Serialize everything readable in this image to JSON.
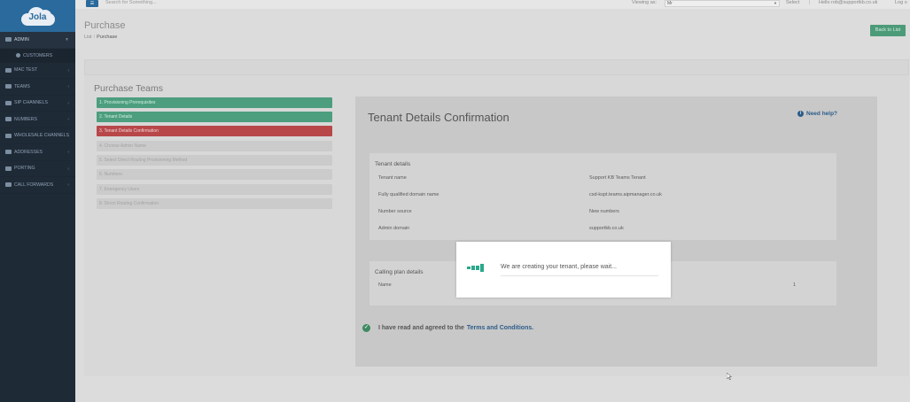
{
  "brand": {
    "logo_text": "Jola"
  },
  "sidebar": {
    "items": [
      {
        "label": "ADMIN",
        "active": true
      },
      {
        "label": "MAC TEST"
      },
      {
        "label": "TEAMS"
      },
      {
        "label": "SIP CHANNELS"
      },
      {
        "label": "NUMBERS"
      },
      {
        "label": "WHOLESALE CHANNELS"
      },
      {
        "label": "ADDRESSES"
      },
      {
        "label": "PORTING"
      },
      {
        "label": "CALL FORWARDS"
      }
    ],
    "sub_item": {
      "label": "CUSTOMERS"
    }
  },
  "topbar": {
    "menu_icon": "hamburger-icon",
    "search_placeholder": "Search for Something...",
    "viewing_label": "Viewing as:",
    "viewing_value": "Mr",
    "select_label": "Select",
    "separator": "|",
    "user_email": "Hello rob@supportkb.co.uk",
    "logout_label": "Log o"
  },
  "header": {
    "title": "Purchase",
    "breadcrumb": [
      "List",
      "Purchase"
    ],
    "back_label": "Back to List"
  },
  "steps": {
    "heading": "Purchase Teams",
    "items": [
      {
        "label": "1. Provisioning Prerequisites",
        "state": "done"
      },
      {
        "label": "2. Tenant Details",
        "state": "done"
      },
      {
        "label": "3. Tenant Details Confirmation",
        "state": "current"
      },
      {
        "label": "4. Choose Admin Name",
        "state": "pending"
      },
      {
        "label": "5. Select Direct Routing Provisioning Method",
        "state": "pending"
      },
      {
        "label": "6. Numbers",
        "state": "pending"
      },
      {
        "label": "7. Emergency Users",
        "state": "pending"
      },
      {
        "label": "8. Direct Routing Confirmation",
        "state": "pending"
      }
    ]
  },
  "panel": {
    "title": "Tenant Details Confirmation",
    "help_label": "Need help?",
    "tenant_details": {
      "title": "Tenant details",
      "rows": [
        {
          "label": "Tenant name",
          "value": "Support KB Teams Tenant"
        },
        {
          "label": "Fully qualified domain name",
          "value": "csd-kspt.teams.aipmanager.co.uk"
        },
        {
          "label": "Number source",
          "value": "New numbers"
        },
        {
          "label": "Admin domain",
          "value": "supportkb.co.uk"
        }
      ]
    },
    "calling_plan": {
      "title": "Calling plan details",
      "name_label": "Name",
      "value": "1"
    },
    "agree_text": "I have read and agreed to the",
    "terms_label": "Terms and Conditions."
  },
  "modal": {
    "message": "We are creating your tenant, please wait..."
  },
  "colors": {
    "sidebar": "#1f2a37",
    "brand_blue": "#2a6a9c",
    "step_done": "#4c9e7e",
    "step_current": "#b8474a",
    "link": "#2d5d8a",
    "spinner": "#2aa88a"
  }
}
